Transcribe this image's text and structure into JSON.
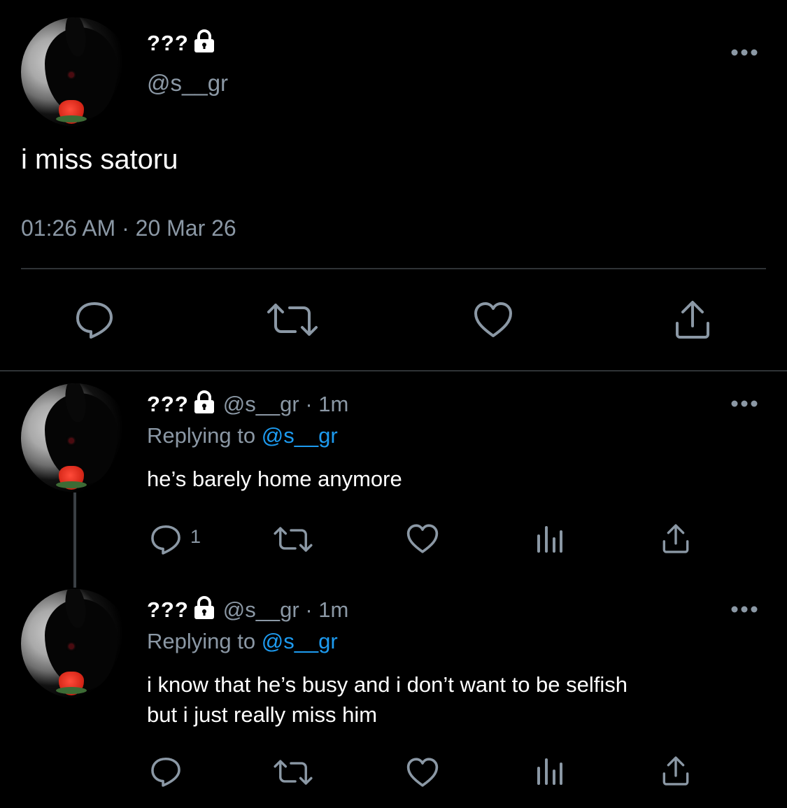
{
  "main_tweet": {
    "display_name": "???",
    "handle": "@s__gr",
    "text": "i miss satoru",
    "timestamp": "01:26 AM · 20 Mar 26"
  },
  "replies": [
    {
      "display_name": "???",
      "meta": "@s__gr · 1m",
      "replying_prefix": "Replying to ",
      "replying_handle": "@s__gr",
      "text_lines": [
        "he’s barely home anymore"
      ],
      "reply_count": "1"
    },
    {
      "display_name": "???",
      "meta": "@s__gr · 1m",
      "replying_prefix": "Replying to ",
      "replying_handle": "@s__gr",
      "text_lines": [
        "i know that he’s busy and i don’t want to be selfish",
        "but i just really miss him"
      ],
      "reply_count": ""
    }
  ],
  "icons": {
    "more": "more-icon",
    "reply": "reply-icon",
    "retweet": "retweet-icon",
    "like": "like-icon",
    "share": "share-icon",
    "analytics": "analytics-icon",
    "lock": "lock-icon"
  },
  "colors": {
    "background": "#000000",
    "muted": "#8b98a5",
    "link": "#1d9bf0",
    "divider": "#2f3336"
  }
}
